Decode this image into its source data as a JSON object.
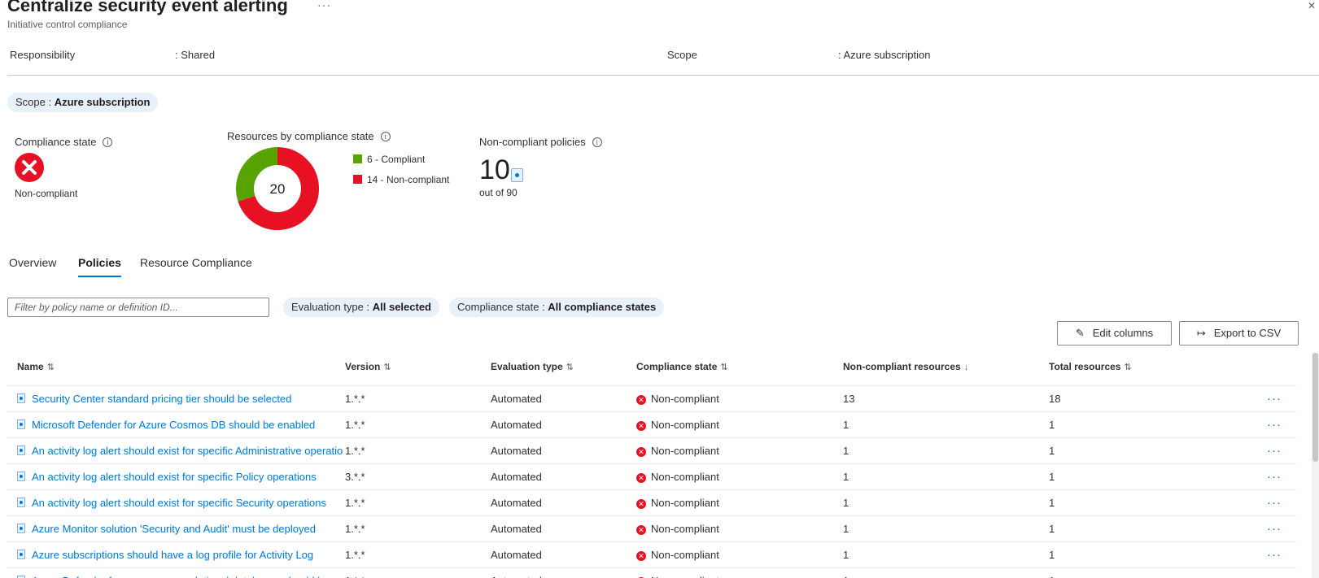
{
  "header": {
    "title": "Centralize security event alerting",
    "subtitle": "Initiative control compliance",
    "more_label": "···"
  },
  "properties": {
    "responsibility_label": "Responsibility",
    "responsibility_value": ": Shared",
    "scope_label": "Scope",
    "scope_value": ": Azure subscription"
  },
  "scope_pill": {
    "label": "Scope : ",
    "value": "Azure subscription"
  },
  "compliance_state": {
    "label": "Compliance state",
    "value": "Non-compliant",
    "status_color": "#e81123"
  },
  "resources_chart": {
    "label": "Resources by compliance state",
    "total": "20"
  },
  "chart_data": {
    "type": "pie",
    "total": 20,
    "categories": [
      "Compliant",
      "Non-compliant"
    ],
    "values": [
      6,
      14
    ],
    "colors": [
      "#57a300",
      "#e81123"
    ],
    "legend": [
      "6 - Compliant",
      "14 - Non-compliant"
    ],
    "legend_placement": "right"
  },
  "noncompliant_policies": {
    "label": "Non-compliant policies",
    "count": "10",
    "out_of": "out of 90"
  },
  "tabs": [
    {
      "label": "Overview",
      "active": false
    },
    {
      "label": "Policies",
      "active": true
    },
    {
      "label": "Resource Compliance",
      "active": false
    }
  ],
  "filters": {
    "search_placeholder": "Filter by policy name or definition ID...",
    "evaluation_type_label": "Evaluation type : ",
    "evaluation_type_value": "All selected",
    "compliance_state_label": "Compliance state : ",
    "compliance_state_value": "All compliance states"
  },
  "toolbar": {
    "edit_columns_label": "Edit columns",
    "export_csv_label": "Export to CSV"
  },
  "table": {
    "columns": [
      {
        "label": "Name",
        "sort": "⇅"
      },
      {
        "label": "Version",
        "sort": "⇅"
      },
      {
        "label": "Evaluation type",
        "sort": "⇅"
      },
      {
        "label": "Compliance state",
        "sort": "⇅"
      },
      {
        "label": "Non-compliant resources",
        "sort": "↓"
      },
      {
        "label": "Total resources",
        "sort": "⇅"
      }
    ],
    "rows": [
      {
        "name": "Security Center standard pricing tier should be selected",
        "version": "1.*.*",
        "evaluation": "Automated",
        "state": "Non-compliant",
        "noncompliant": "13",
        "total": "18"
      },
      {
        "name": "Microsoft Defender for Azure Cosmos DB should be enabled",
        "version": "1.*.*",
        "evaluation": "Automated",
        "state": "Non-compliant",
        "noncompliant": "1",
        "total": "1"
      },
      {
        "name": "An activity log alert should exist for specific Administrative operations",
        "version": "1.*.*",
        "evaluation": "Automated",
        "state": "Non-compliant",
        "noncompliant": "1",
        "total": "1"
      },
      {
        "name": "An activity log alert should exist for specific Policy operations",
        "version": "3.*.*",
        "evaluation": "Automated",
        "state": "Non-compliant",
        "noncompliant": "1",
        "total": "1"
      },
      {
        "name": "An activity log alert should exist for specific Security operations",
        "version": "1.*.*",
        "evaluation": "Automated",
        "state": "Non-compliant",
        "noncompliant": "1",
        "total": "1"
      },
      {
        "name": "Azure Monitor solution 'Security and Audit' must be deployed",
        "version": "1.*.*",
        "evaluation": "Automated",
        "state": "Non-compliant",
        "noncompliant": "1",
        "total": "1"
      },
      {
        "name": "Azure subscriptions should have a log profile for Activity Log",
        "version": "1.*.*",
        "evaluation": "Automated",
        "state": "Non-compliant",
        "noncompliant": "1",
        "total": "1"
      },
      {
        "name": "Azure Defender for open-source relational databases should be enabled",
        "version": "1.*.*",
        "evaluation": "Automated",
        "state": "Non-compliant",
        "noncompliant": "1",
        "total": "1"
      }
    ],
    "row_more_label": "···"
  }
}
